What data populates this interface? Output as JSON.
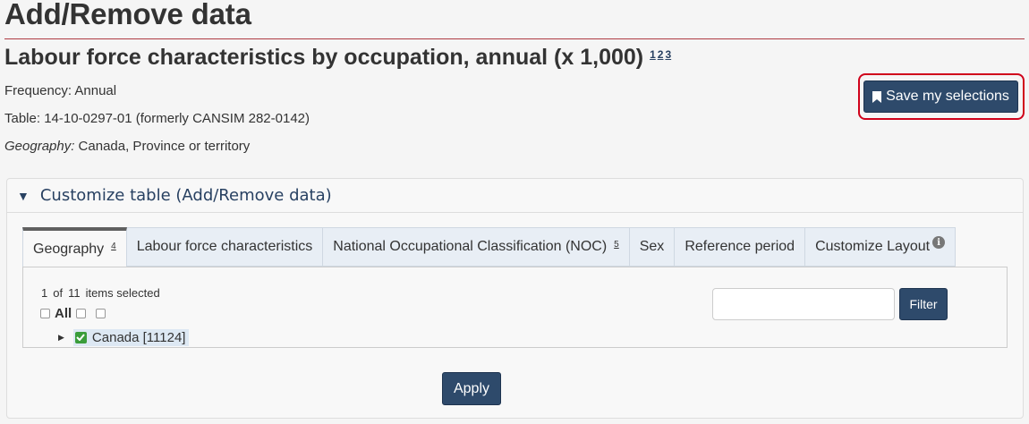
{
  "page": {
    "title": "Add/Remove data"
  },
  "table": {
    "title": "Labour force characteristics by occupation, annual (x 1,000)",
    "footnotes": [
      "1",
      "2",
      "3"
    ],
    "frequency": "Frequency: Annual",
    "table_id": "Table: 14-10-0297-01 (formerly CANSIM 282-0142)",
    "geography_label": "Geography:",
    "geography_value": " Canada, Province or territory"
  },
  "save_button": {
    "label": "Save my selections",
    "icon": "bookmark-icon"
  },
  "panel": {
    "toggle_icon": "▼",
    "title": "Customize table (Add/Remove data)"
  },
  "tabs": [
    {
      "label": "Geography",
      "footnote": "4",
      "active": true
    },
    {
      "label": "Labour force characteristics"
    },
    {
      "label": "National Occupational Classification (NOC)",
      "footnote": "5"
    },
    {
      "label": "Sex"
    },
    {
      "label": "Reference period"
    },
    {
      "label": "Customize Layout",
      "icon": "info-icon"
    }
  ],
  "selection": {
    "selected": "1",
    "of_label": "of",
    "total": "11",
    "suffix": "items selected",
    "all_label": "All"
  },
  "tree": {
    "item_label": "Canada [11124]"
  },
  "filter": {
    "placeholder": "",
    "button_label": "Filter"
  },
  "apply_button": {
    "label": "Apply"
  },
  "colors": {
    "primary": "#2e4a6b",
    "accent_red": "#d0021b",
    "rule": "#af3c43",
    "link": "#284162"
  }
}
